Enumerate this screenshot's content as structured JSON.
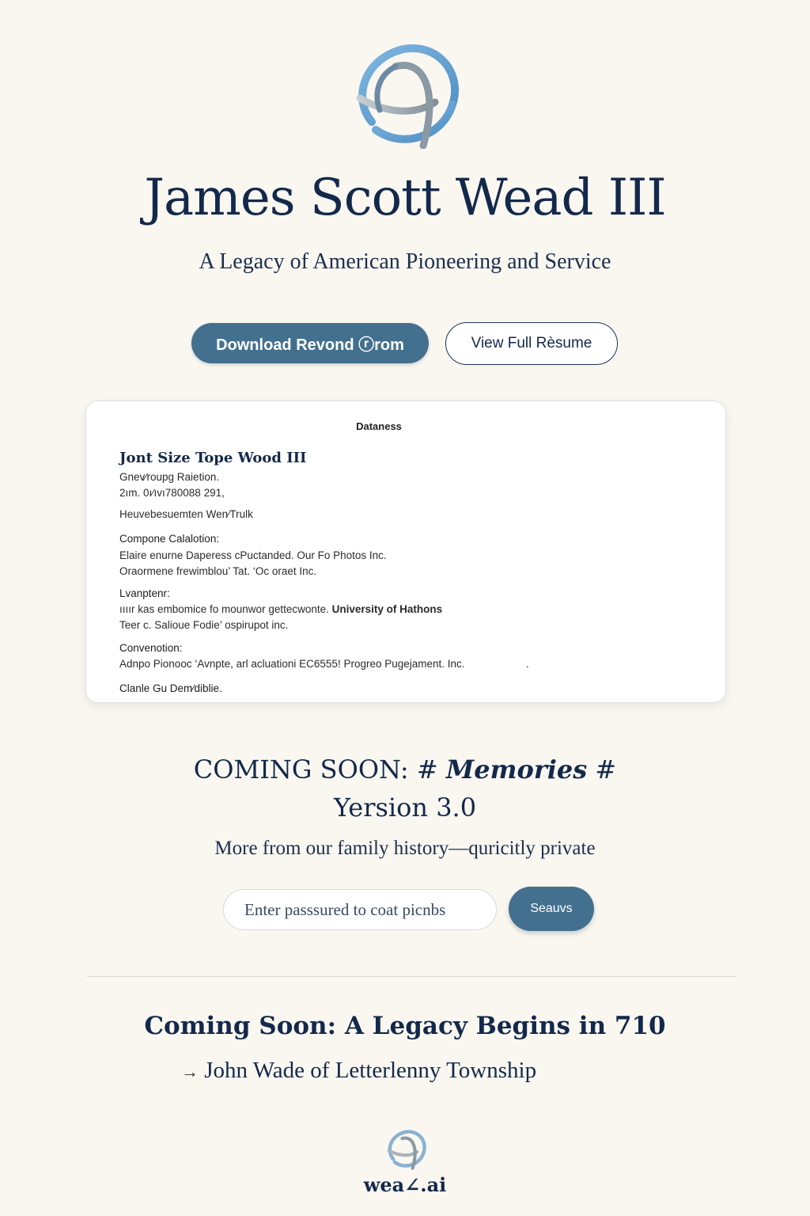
{
  "colors": {
    "background": "#faf7f1",
    "navy": "#13294b",
    "accent_button": "#44708f",
    "logo_blue": "#6aa5d4",
    "logo_grey": "#8b9aa6"
  },
  "header": {
    "logo_icon": "interlocking-rings-logo",
    "title": "James Scott Wead III",
    "subtitle": "A Legacy of American Pioneering and Service"
  },
  "actions": {
    "primary_label": "Download Revond ⓡrom",
    "secondary_label": "View Full Rèsume"
  },
  "resume_card": {
    "header": "Dataness",
    "name": "Jont Size Tope Wood III",
    "line1": "Gnev∕roupg Raietion.",
    "line2": "2ım. 0ı∕ıvı780088 291,",
    "line3": "Heuvebesuemten Wen∕Trulk",
    "section1_label": "Compone Calalotion:",
    "section1_line1": "Elaire enurne Daperess cPuctanded. Our Fo Photos Inc.",
    "section1_line2": "Oraormene frewimblou’ Tat. ‘Oc oraet Inc.",
    "section2_label": "Lvanptenr:",
    "section2_line1": "ıııır kas embomice fo mounwor gettecwonte.",
    "section2_line1_bold": "University of Hathons",
    "section2_line2": "Teer c. Salioue Fodie’ ospirupot inc.",
    "section3_label": "Convenotion:",
    "section3_line1": "Adnpo Pionooc ‘Avnpte, arl acluationi EC6555! Progreo Pugejament. Inc.",
    "section3_trailing_dot": ".",
    "section4_label": "Clanle Gu Dem∕diblie."
  },
  "memories": {
    "coming_prefix": "COMING SOON",
    "colon": ":",
    "hash_left": "#",
    "memories_word": "Memories",
    "hash_right": "#",
    "version": "Yersion 3.0",
    "private_text": "More from our family history—quricitly private",
    "password_placeholder": "Enter passsured to coat picnbs",
    "submit_label": "Seauvs"
  },
  "legacy": {
    "title": "Coming Soon: A Legacy Begins in 710",
    "arrow": "→",
    "subtitle": "John Wade of Letterlenny Township"
  },
  "footer": {
    "logo_icon": "interlocking-rings-logo",
    "brand": "wea∠.ai"
  }
}
